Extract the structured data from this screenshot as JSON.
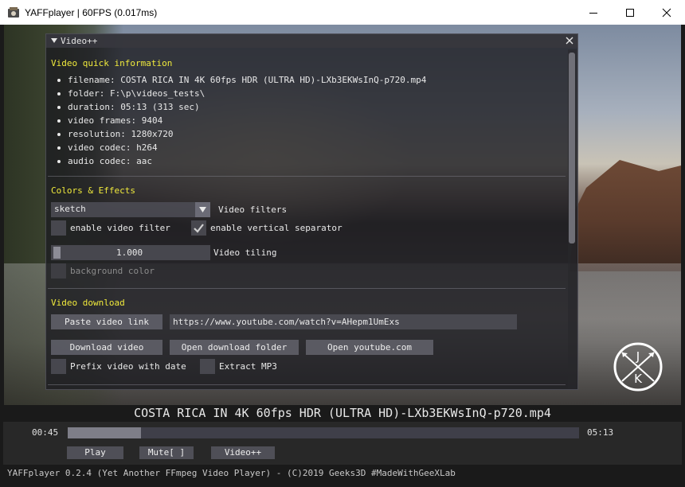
{
  "window": {
    "title": "YAFFplayer | 60FPS (0.017ms)"
  },
  "panel": {
    "title": "Video++",
    "info": {
      "heading": "Video quick information",
      "items": [
        "filename: COSTA RICA IN 4K 60fps HDR (ULTRA HD)-LXb3EKWsInQ-p720.mp4",
        "folder: F:\\p\\videos_tests\\",
        "duration: 05:13 (313 sec)",
        "video frames: 9404",
        "resolution: 1280x720",
        "video codec: h264",
        "audio codec: aac"
      ]
    },
    "effects": {
      "heading": "Colors & Effects",
      "filter_value": "sketch",
      "filter_label": "Video filters",
      "enable_filter_label": "enable video filter",
      "enable_filter_checked": false,
      "vertical_separator_label": "enable vertical separator",
      "vertical_separator_checked": true,
      "tiling_value": "1.000",
      "tiling_label": "Video tiling",
      "background_color_label": "background color"
    },
    "download": {
      "heading": "Video download",
      "paste_button": "Paste video link",
      "url_value": "https://www.youtube.com/watch?v=AHepm1UmExs",
      "download_button": "Download video",
      "open_folder_button": "Open download folder",
      "open_youtube_button": "Open youtube.com",
      "prefix_label": "Prefix video with date",
      "prefix_checked": false,
      "extract_mp3_label": "Extract MP3",
      "extract_mp3_checked": false
    }
  },
  "player": {
    "filename": "COSTA RICA IN 4K 60fps HDR (ULTRA HD)-LXb3EKWsInQ-p720.mp4",
    "current_time": "00:45",
    "total_time": "05:13",
    "progress_fraction": 0.144,
    "play_button": "Play",
    "mute_button": "Mute[ ]",
    "videopp_button": "Video++"
  },
  "footer": {
    "text": "YAFFplayer 0.2.4 (Yet Another FFmpeg Video Player) - (C)2019 Geeks3D  #MadeWithGeeXLab"
  },
  "colors": {
    "heading": "#f0ea3c",
    "panel_bg": "#1c1c20",
    "button": "#5f5f68"
  },
  "icons": [
    "app-icon",
    "minimize-icon",
    "maximize-icon",
    "close-icon",
    "collapse-arrow-icon",
    "panel-close-icon",
    "dropdown-arrow-icon",
    "checkmark-icon",
    "jk-logo-icon"
  ]
}
